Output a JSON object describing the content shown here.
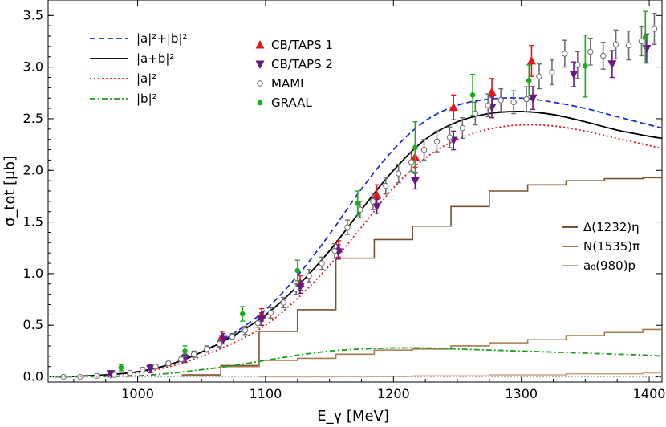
{
  "chart_data": {
    "type": "scatter",
    "xlabel": "E_γ [MeV]",
    "ylabel": "σ_tot [μb]",
    "xlim": [
      930,
      1410
    ],
    "ylim": [
      -0.05,
      3.65
    ],
    "xticks": [
      1000,
      1100,
      1200,
      1300,
      1400
    ],
    "yticks": [
      0.0,
      0.5,
      1.0,
      1.5,
      2.0,
      2.5,
      3.0,
      3.5
    ],
    "xtick_labels": [
      "1000",
      "1100",
      "1200",
      "1300",
      "1400"
    ],
    "ytick_labels": [
      "0.0",
      "0.5",
      "1.0",
      "1.5",
      "2.0",
      "2.5",
      "3.0",
      "3.5"
    ],
    "grid": false,
    "legends": {
      "curves": {
        "placement": "top-left",
        "entries": [
          "|a|²+|b|²",
          "|a+b|²",
          "|a|²",
          "|b|²"
        ]
      },
      "data": {
        "placement": "top-center",
        "entries": [
          "CB/TAPS 1",
          "CB/TAPS 2",
          "MAMI",
          "GRAAL"
        ]
      },
      "histograms": {
        "placement": "right",
        "entries": [
          "Δ(1232)η",
          "N(1535)π",
          "a₀(980)p"
        ]
      }
    },
    "curves": [
      {
        "name": "|a|²+|b|²",
        "color": "#1f2fd6",
        "style": "dashed",
        "x": [
          935,
          950,
          975,
          1000,
          1025,
          1050,
          1075,
          1100,
          1125,
          1150,
          1175,
          1200,
          1225,
          1250,
          1275,
          1300,
          1325,
          1350,
          1375,
          1400,
          1410
        ],
        "y": [
          0.0,
          0.005,
          0.02,
          0.05,
          0.12,
          0.24,
          0.42,
          0.65,
          0.98,
          1.38,
          1.82,
          2.2,
          2.48,
          2.63,
          2.69,
          2.7,
          2.66,
          2.6,
          2.52,
          2.44,
          2.41
        ]
      },
      {
        "name": "|a+b|²",
        "color": "#000000",
        "style": "solid",
        "x": [
          935,
          950,
          975,
          1000,
          1025,
          1050,
          1075,
          1100,
          1125,
          1150,
          1175,
          1200,
          1225,
          1250,
          1275,
          1300,
          1325,
          1350,
          1375,
          1400,
          1410
        ],
        "y": [
          0.0,
          0.005,
          0.02,
          0.05,
          0.12,
          0.24,
          0.4,
          0.6,
          0.88,
          1.22,
          1.62,
          2.0,
          2.3,
          2.47,
          2.55,
          2.57,
          2.54,
          2.47,
          2.39,
          2.33,
          2.31
        ]
      },
      {
        "name": "|a|²",
        "color": "#e8141b",
        "style": "dotted",
        "x": [
          935,
          950,
          975,
          1000,
          1025,
          1050,
          1075,
          1100,
          1125,
          1150,
          1175,
          1200,
          1225,
          1250,
          1275,
          1300,
          1325,
          1350,
          1375,
          1400,
          1410
        ],
        "y": [
          0.0,
          0.004,
          0.015,
          0.04,
          0.1,
          0.2,
          0.33,
          0.5,
          0.76,
          1.08,
          1.45,
          1.83,
          2.12,
          2.3,
          2.4,
          2.44,
          2.43,
          2.38,
          2.31,
          2.24,
          2.21
        ]
      },
      {
        "name": "|b|²",
        "color": "#1a9e1a",
        "style": "dashdot",
        "x": [
          935,
          975,
          1000,
          1025,
          1050,
          1075,
          1100,
          1125,
          1150,
          1175,
          1200,
          1225,
          1250,
          1275,
          1300,
          1325,
          1350,
          1375,
          1400,
          1410
        ],
        "y": [
          0.0,
          0.003,
          0.01,
          0.035,
          0.07,
          0.11,
          0.16,
          0.21,
          0.25,
          0.27,
          0.28,
          0.28,
          0.27,
          0.26,
          0.25,
          0.24,
          0.23,
          0.22,
          0.21,
          0.2
        ]
      }
    ],
    "histograms": [
      {
        "name": "Δ(1232)η",
        "color": "#7a5230",
        "edges": [
          1035,
          1065,
          1095,
          1125,
          1155,
          1185,
          1215,
          1245,
          1275,
          1305,
          1335,
          1365,
          1395,
          1410
        ],
        "values": [
          0.02,
          0.11,
          0.44,
          0.65,
          1.15,
          1.33,
          1.46,
          1.65,
          1.8,
          1.86,
          1.9,
          1.92,
          1.93
        ]
      },
      {
        "name": "N(1535)π",
        "color": "#a77a4d",
        "edges": [
          1035,
          1065,
          1095,
          1125,
          1155,
          1185,
          1215,
          1245,
          1275,
          1305,
          1335,
          1365,
          1395,
          1410
        ],
        "values": [
          0.01,
          0.1,
          0.16,
          0.18,
          0.22,
          0.26,
          0.27,
          0.3,
          0.33,
          0.36,
          0.4,
          0.43,
          0.46
        ]
      },
      {
        "name": "a₀(980)p",
        "color": "#c9a687",
        "edges": [
          1095,
          1155,
          1215,
          1275,
          1335,
          1395,
          1410
        ],
        "values": [
          0.002,
          0.005,
          0.01,
          0.02,
          0.03,
          0.04
        ]
      }
    ],
    "points": [
      {
        "name": "CB/TAPS 1",
        "color": "#e8141b",
        "marker": "triangle-up",
        "x": [
          1066,
          1097,
          1127,
          1157,
          1187,
          1217,
          1247,
          1277,
          1308
        ],
        "y": [
          0.39,
          0.6,
          0.91,
          1.24,
          1.76,
          2.13,
          2.61,
          2.76,
          3.06
        ],
        "err": [
          0.05,
          0.06,
          0.07,
          0.08,
          0.1,
          0.1,
          0.12,
          0.13,
          0.15
        ]
      },
      {
        "name": "CB/TAPS 2",
        "color": "#6b1887",
        "marker": "triangle-down",
        "x": [
          979,
          1010,
          1037,
          1067,
          1097,
          1127,
          1157,
          1187,
          1217,
          1247,
          1277,
          1309,
          1341,
          1371,
          1398
        ],
        "y": [
          0.03,
          0.08,
          0.18,
          0.37,
          0.56,
          0.87,
          1.21,
          1.65,
          1.9,
          2.29,
          2.61,
          2.7,
          2.93,
          3.03,
          3.18
        ],
        "err": [
          0.03,
          0.04,
          0.04,
          0.05,
          0.06,
          0.06,
          0.07,
          0.07,
          0.08,
          0.09,
          0.1,
          0.11,
          0.12,
          0.13,
          0.14
        ]
      },
      {
        "name": "MAMI",
        "color": "#6e6e6e",
        "marker": "open-circle",
        "x": [
          942,
          955,
          968,
          982,
          994,
          1004,
          1014,
          1024,
          1034,
          1044,
          1054,
          1064,
          1074,
          1084,
          1094,
          1104,
          1114,
          1124,
          1134,
          1144,
          1154,
          1164,
          1174,
          1184,
          1194,
          1204,
          1214,
          1224,
          1234,
          1244,
          1254,
          1264,
          1274,
          1284,
          1294,
          1304,
          1314,
          1324,
          1334,
          1344,
          1354,
          1364,
          1374,
          1384,
          1394,
          1404
        ],
        "y": [
          0.0,
          0.0,
          0.01,
          0.02,
          0.04,
          0.07,
          0.1,
          0.13,
          0.17,
          0.22,
          0.27,
          0.32,
          0.39,
          0.45,
          0.52,
          0.62,
          0.72,
          0.85,
          0.98,
          1.1,
          1.22,
          1.45,
          1.62,
          1.7,
          1.85,
          1.97,
          2.08,
          2.2,
          2.28,
          2.32,
          2.41,
          2.55,
          2.63,
          2.68,
          2.66,
          2.69,
          2.91,
          2.95,
          3.13,
          3.02,
          3.15,
          3.11,
          3.22,
          3.21,
          3.25,
          3.37
        ],
        "err": [
          0.01,
          0.01,
          0.01,
          0.01,
          0.01,
          0.02,
          0.02,
          0.02,
          0.02,
          0.03,
          0.03,
          0.03,
          0.03,
          0.04,
          0.04,
          0.05,
          0.05,
          0.05,
          0.06,
          0.06,
          0.07,
          0.07,
          0.08,
          0.08,
          0.08,
          0.09,
          0.09,
          0.1,
          0.1,
          0.1,
          0.1,
          0.11,
          0.11,
          0.11,
          0.11,
          0.12,
          0.12,
          0.12,
          0.13,
          0.13,
          0.13,
          0.13,
          0.14,
          0.14,
          0.14,
          0.15
        ]
      },
      {
        "name": "GRAAL",
        "color": "#1aad1a",
        "marker": "filled-circle",
        "x": [
          987,
          1037,
          1082,
          1125,
          1172,
          1217,
          1262,
          1306,
          1350,
          1397
        ],
        "y": [
          0.09,
          0.25,
          0.61,
          1.03,
          1.68,
          2.22,
          2.73,
          2.87,
          3.01,
          3.29
        ],
        "err": [
          0.03,
          0.05,
          0.07,
          0.1,
          0.12,
          0.25,
          0.2,
          0.15,
          0.3,
          0.25
        ]
      }
    ]
  }
}
